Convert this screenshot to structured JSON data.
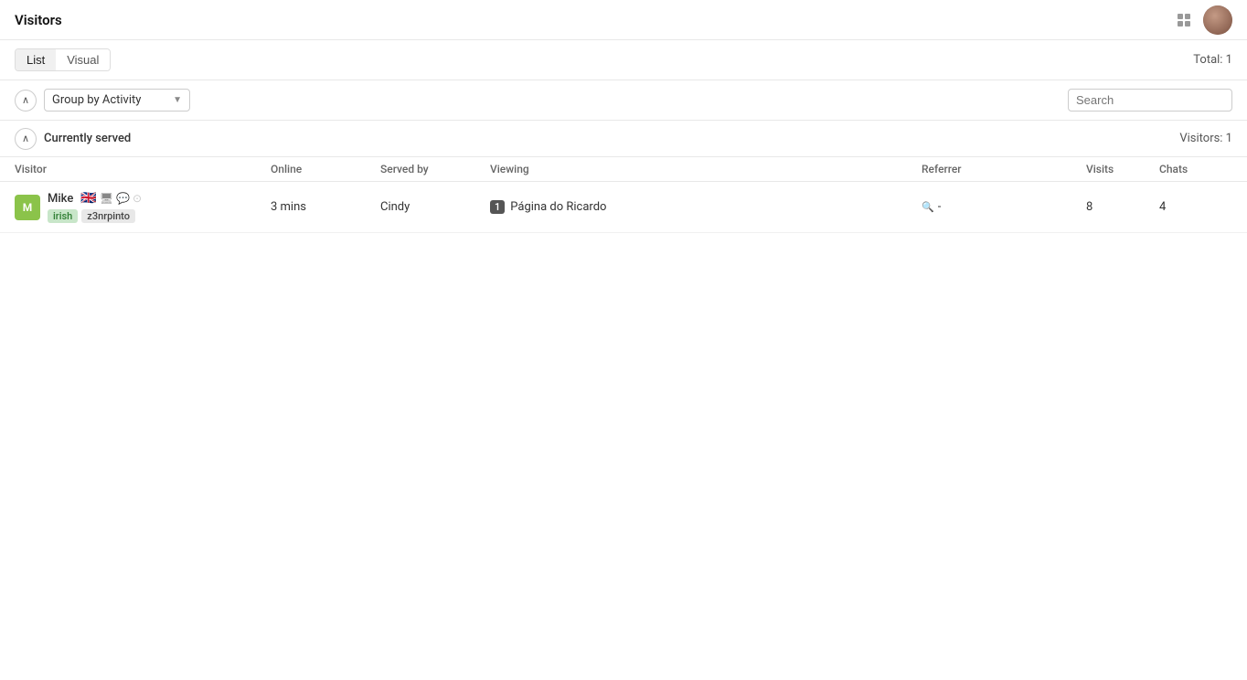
{
  "header": {
    "title": "Visitors",
    "total_label": "Total: 1",
    "grid_icon": "grid-icon",
    "avatar": "user-avatar"
  },
  "view_tabs": [
    {
      "id": "list",
      "label": "List",
      "active": true
    },
    {
      "id": "visual",
      "label": "Visual",
      "active": false
    }
  ],
  "filter": {
    "group_by_label": "Group by Activity",
    "search_placeholder": "Search",
    "collapse_icon": "chevron-up"
  },
  "section": {
    "title": "Currently served",
    "visitors_count_label": "Visitors: 1"
  },
  "table": {
    "columns": [
      "Visitor",
      "Online",
      "Served by",
      "Viewing",
      "Referrer",
      "Visits",
      "Chats"
    ],
    "rows": [
      {
        "visitor_name": "Mike",
        "visitor_initials": "M",
        "tags": [
          "irish",
          "z3nrpinto"
        ],
        "flags": [
          "🇬🇧"
        ],
        "devices": [
          "🖥",
          "💬",
          "⊙"
        ],
        "online": "3 mins",
        "served_by": "Cindy",
        "viewing_count": 1,
        "viewing_page": "Página do Ricardo",
        "referrer": "-",
        "visits": 8,
        "chats": 4
      }
    ]
  }
}
